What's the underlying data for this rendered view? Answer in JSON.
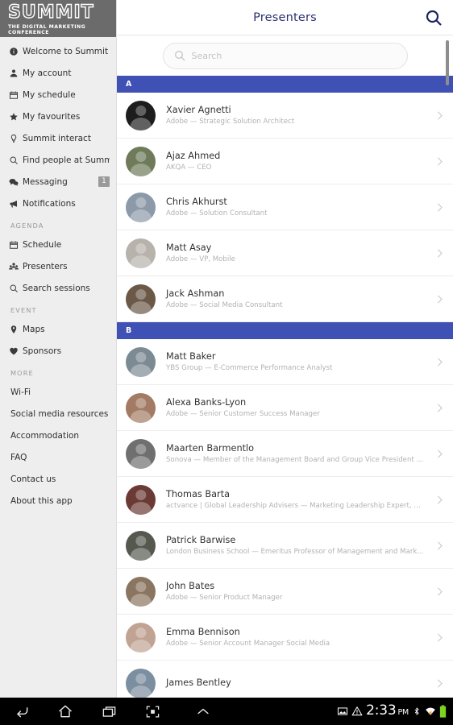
{
  "sidebar": {
    "logo": {
      "word": "SUMMIT",
      "tagline": "THE DIGITAL MARKETING CONFERENCE"
    },
    "items": [
      {
        "label": "Welcome to Summit",
        "icon": "info-icon"
      },
      {
        "label": "My account",
        "icon": "person-icon"
      },
      {
        "label": "My schedule",
        "icon": "calendar-icon"
      },
      {
        "label": "My favourites",
        "icon": "star-icon"
      },
      {
        "label": "Summit interact",
        "icon": "bulb-icon"
      },
      {
        "label": "Find people at Summit",
        "icon": "search-icon"
      },
      {
        "label": "Messaging",
        "icon": "chat-icon",
        "badge": "1"
      },
      {
        "label": "Notifications",
        "icon": "megaphone-icon"
      }
    ],
    "groups": [
      {
        "title": "AGENDA",
        "items": [
          {
            "label": "Schedule",
            "icon": "calendar-icon"
          },
          {
            "label": "Presenters",
            "icon": "people-icon"
          },
          {
            "label": "Search sessions",
            "icon": "search-icon"
          }
        ]
      },
      {
        "title": "EVENT",
        "items": [
          {
            "label": "Maps",
            "icon": "pin-icon"
          },
          {
            "label": "Sponsors",
            "icon": "heart-icon"
          }
        ]
      },
      {
        "title": "MORE",
        "items": [
          {
            "label": "Wi-Fi",
            "icon": ""
          },
          {
            "label": "Social media resources",
            "icon": ""
          },
          {
            "label": "Accommodation",
            "icon": ""
          },
          {
            "label": "FAQ",
            "icon": ""
          },
          {
            "label": "Contact us",
            "icon": ""
          },
          {
            "label": "About this app",
            "icon": ""
          }
        ]
      }
    ]
  },
  "header": {
    "title": "Presenters",
    "search_icon": "search-icon"
  },
  "search": {
    "placeholder": "Search",
    "value": "",
    "icon": "search-icon"
  },
  "list": [
    {
      "type": "section",
      "label": "A"
    },
    {
      "type": "row",
      "name": "Xavier Agnetti",
      "subtitle": "Adobe — Strategic Solution Architect",
      "avatar": "#1d1d1d"
    },
    {
      "type": "row",
      "name": "Ajaz Ahmed",
      "subtitle": "AKQA — CEO",
      "avatar": "#6e7a5a"
    },
    {
      "type": "row",
      "name": "Chris Akhurst",
      "subtitle": "Adobe — Solution Consultant",
      "avatar": "#8c99a8"
    },
    {
      "type": "row",
      "name": "Matt Asay",
      "subtitle": "Adobe — VP, Mobile",
      "avatar": "#b7b2ab"
    },
    {
      "type": "row",
      "name": "Jack Ashman",
      "subtitle": "Adobe — Social Media Consultant",
      "avatar": "#6b5847"
    },
    {
      "type": "section",
      "label": "B"
    },
    {
      "type": "row",
      "name": "Matt Baker",
      "subtitle": "YBS Group — E-Commerce Performance Analyst",
      "avatar": "#7b8a93"
    },
    {
      "type": "row",
      "name": "Alexa Banks-Lyon",
      "subtitle": "Adobe — Senior Customer Success Manager",
      "avatar": "#a37a63"
    },
    {
      "type": "row",
      "name": "Maarten Barmentlo",
      "subtitle": "Sonova — Member of the Management Board and Group Vice President Marketing",
      "avatar": "#6f6f6f"
    },
    {
      "type": "row",
      "name": "Thomas Barta",
      "subtitle": "actvance | Global Leadership Advisers — Marketing Leadership Expert, Managing Director",
      "avatar": "#6b3a34"
    },
    {
      "type": "row",
      "name": "Patrick Barwise",
      "subtitle": "London Business School — Emeritus Professor of Management and Marketing",
      "avatar": "#55584f"
    },
    {
      "type": "row",
      "name": "John Bates",
      "subtitle": "Adobe — Senior Product Manager",
      "avatar": "#8a7560"
    },
    {
      "type": "row",
      "name": "Emma Bennison",
      "subtitle": "Adobe — Senior Account Manager Social Media",
      "avatar": "#c0a393"
    },
    {
      "type": "row",
      "name": "James Bentley",
      "subtitle": "",
      "avatar": "#7b8fa0"
    }
  ],
  "navbar": {
    "buttons": [
      "back-icon",
      "home-icon",
      "recents-icon",
      "screenshot-icon",
      "expand-up-icon"
    ],
    "status": {
      "image_icon": "image-icon",
      "warning_icon": "warning-icon",
      "time": "2:33",
      "ampm": "PM",
      "bluetooth_icon": "bluetooth-icon",
      "wifi_icon": "wifi-icon",
      "battery_icon": "battery-icon"
    }
  },
  "colors": {
    "accent_blue": "#3f51b5",
    "title_navy": "#2b2f72",
    "sidebar_bg": "#eeeeee",
    "logo_bg": "#6b6b6b",
    "battery_green": "#7ed321",
    "wifi_orange": "#f0a030"
  }
}
